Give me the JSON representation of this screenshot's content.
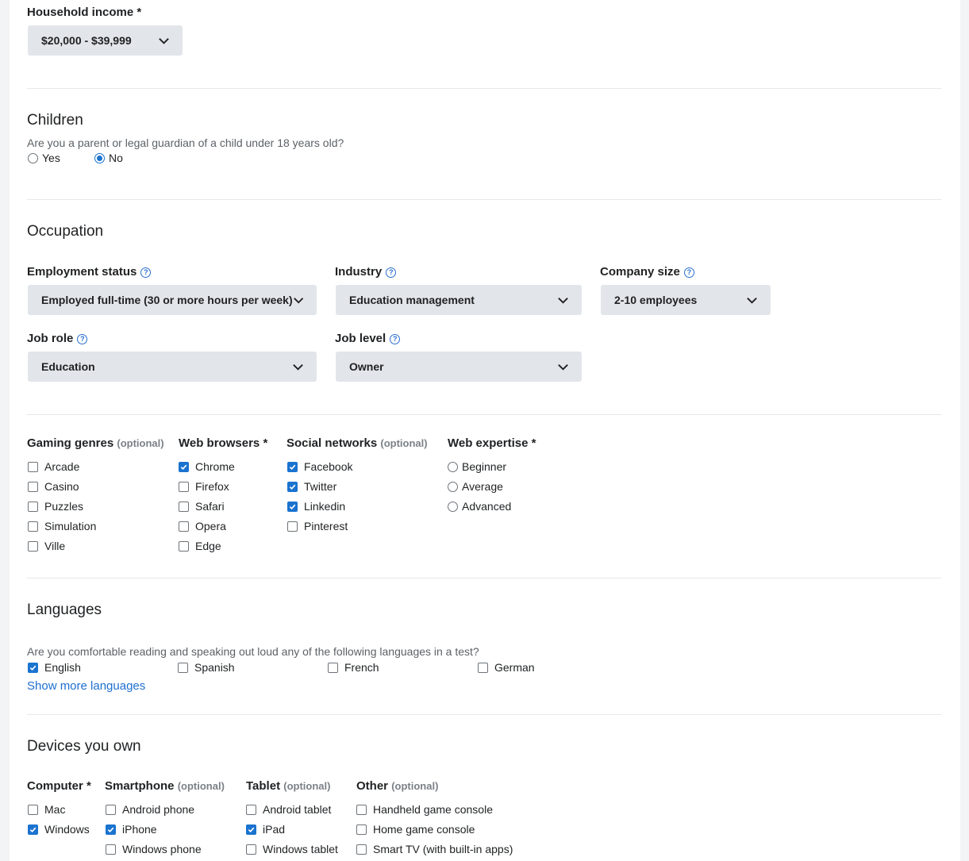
{
  "income": {
    "label": "Household income *",
    "value": "$20,000 - $39,999"
  },
  "children": {
    "title": "Children",
    "question": "Are you a parent or legal guardian of a child under 18 years old?",
    "options": [
      {
        "label": "Yes",
        "selected": false
      },
      {
        "label": "No",
        "selected": true
      }
    ]
  },
  "occupation": {
    "title": "Occupation",
    "employment": {
      "label": "Employment status",
      "value": "Employed full-time (30 or more hours per week)"
    },
    "industry": {
      "label": "Industry",
      "value": "Education management"
    },
    "company_size": {
      "label": "Company size",
      "value": "2-10 employees"
    },
    "job_role": {
      "label": "Job role",
      "value": "Education"
    },
    "job_level": {
      "label": "Job level",
      "value": "Owner"
    },
    "help_glyph": "?"
  },
  "optional_tag": "(optional)",
  "required_mark": "*",
  "gaming": {
    "label": "Gaming genres",
    "items": [
      {
        "label": "Arcade",
        "checked": false
      },
      {
        "label": "Casino",
        "checked": false
      },
      {
        "label": "Puzzles",
        "checked": false
      },
      {
        "label": "Simulation",
        "checked": false
      },
      {
        "label": "Ville",
        "checked": false
      }
    ]
  },
  "browsers": {
    "label": "Web browsers",
    "items": [
      {
        "label": "Chrome",
        "checked": true
      },
      {
        "label": "Firefox",
        "checked": false
      },
      {
        "label": "Safari",
        "checked": false
      },
      {
        "label": "Opera",
        "checked": false
      },
      {
        "label": "Edge",
        "checked": false
      }
    ]
  },
  "social": {
    "label": "Social networks",
    "items": [
      {
        "label": "Facebook",
        "checked": true
      },
      {
        "label": "Twitter",
        "checked": true
      },
      {
        "label": "Linkedin",
        "checked": true
      },
      {
        "label": "Pinterest",
        "checked": false
      }
    ]
  },
  "expertise": {
    "label": "Web expertise",
    "items": [
      {
        "label": "Beginner",
        "selected": false
      },
      {
        "label": "Average",
        "selected": false
      },
      {
        "label": "Advanced",
        "selected": false
      }
    ]
  },
  "languages": {
    "title": "Languages",
    "question": "Are you comfortable reading and speaking out loud any of the following languages in a test?",
    "items": [
      {
        "label": "English",
        "checked": true
      },
      {
        "label": "Spanish",
        "checked": false
      },
      {
        "label": "French",
        "checked": false
      },
      {
        "label": "German",
        "checked": false
      }
    ],
    "show_more": "Show more languages"
  },
  "devices": {
    "title": "Devices you own",
    "computer": {
      "label": "Computer",
      "items": [
        {
          "label": "Mac",
          "checked": false
        },
        {
          "label": "Windows",
          "checked": true
        }
      ]
    },
    "smartphone": {
      "label": "Smartphone",
      "items": [
        {
          "label": "Android phone",
          "checked": false
        },
        {
          "label": "iPhone",
          "checked": true
        },
        {
          "label": "Windows phone",
          "checked": false
        }
      ]
    },
    "tablet": {
      "label": "Tablet",
      "items": [
        {
          "label": "Android tablet",
          "checked": false
        },
        {
          "label": "iPad",
          "checked": true
        },
        {
          "label": "Windows tablet",
          "checked": false
        }
      ]
    },
    "other": {
      "label": "Other",
      "items": [
        {
          "label": "Handheld game console",
          "checked": false
        },
        {
          "label": "Home game console",
          "checked": false
        },
        {
          "label": "Smart TV (with built-in apps)",
          "checked": false
        }
      ]
    }
  },
  "colors": {
    "accent": "#1a73cf",
    "select_bg": "#e2e5e9",
    "link": "#1d6fd0"
  }
}
